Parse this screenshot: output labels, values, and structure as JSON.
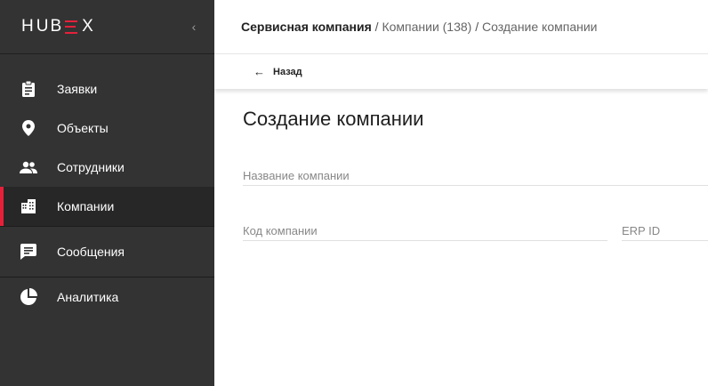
{
  "sidebar": {
    "logo": "HUBEX",
    "items": [
      {
        "label": "Заявки",
        "icon": "clipboard-icon"
      },
      {
        "label": "Объекты",
        "icon": "map-pin-icon"
      },
      {
        "label": "Сотрудники",
        "icon": "people-icon"
      },
      {
        "label": "Компании",
        "icon": "buildings-icon",
        "active": true
      },
      {
        "label": "Сообщения",
        "icon": "message-icon"
      },
      {
        "label": "Аналитика",
        "icon": "pie-chart-icon"
      }
    ]
  },
  "header": {
    "breadcrumb_root": "Сервисная компания",
    "separator": "/",
    "breadcrumb_companies": "Компании (138)",
    "breadcrumb_current": "Создание компании"
  },
  "backbar": {
    "back_label": "Назад"
  },
  "main": {
    "title": "Создание компании",
    "fields": {
      "company_name_placeholder": "Название компании",
      "company_code_placeholder": "Код компании",
      "erp_id_placeholder": "ERP ID"
    }
  },
  "colors": {
    "sidebar_bg": "#333333",
    "active_item_bg": "#272727",
    "accent": "#e6203a"
  }
}
